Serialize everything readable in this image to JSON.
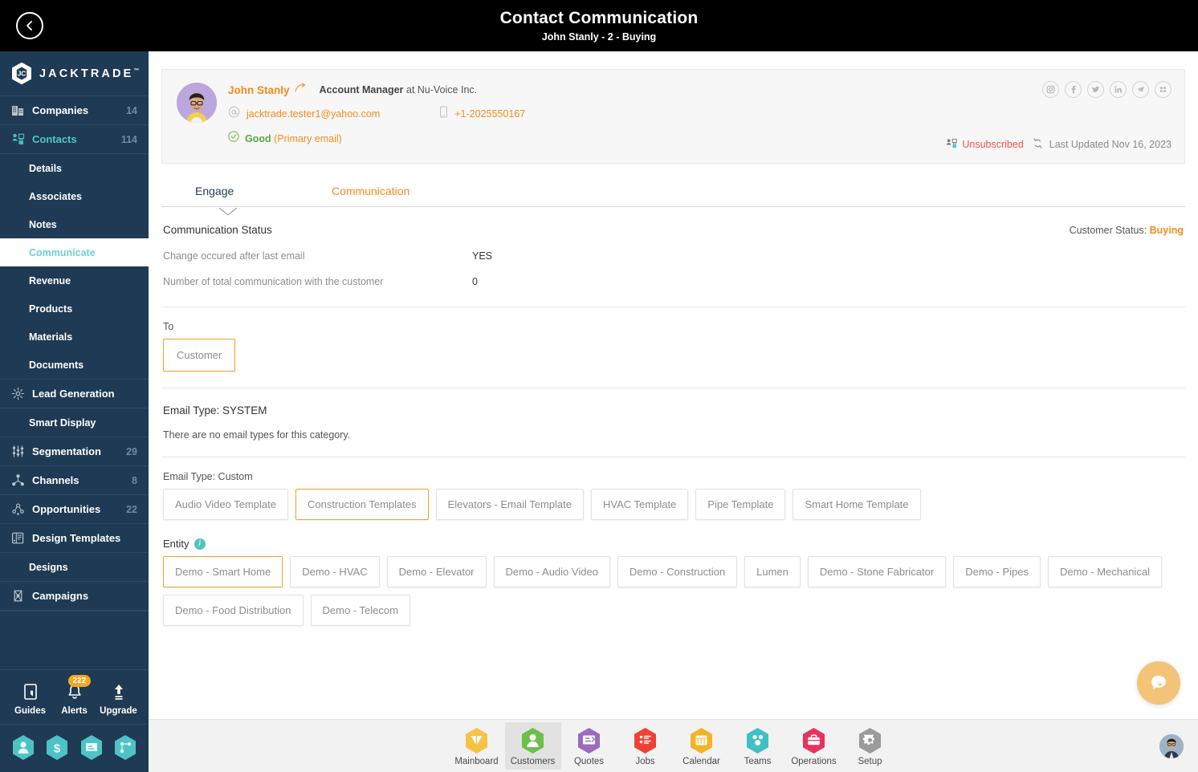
{
  "topbar": {
    "back_icon": "chevron-left-icon",
    "title": "Contact Communication",
    "subtitle": "John Stanly - 2 - Buying"
  },
  "sidebar": {
    "brand": {
      "name": "JACKTRADE",
      "tm": "™",
      "logo_icon": "jacktrade-hex-logo-icon"
    },
    "items": [
      {
        "label": "Companies",
        "count": "14",
        "icon": "building-icon",
        "level": "top",
        "active": false
      },
      {
        "label": "Contacts",
        "count": "114",
        "icon": "contacts-icon",
        "level": "top",
        "active": false,
        "accent": true
      },
      {
        "label": "Details",
        "count": "",
        "icon": "",
        "level": "sub",
        "active": false
      },
      {
        "label": "Associates",
        "count": "",
        "icon": "",
        "level": "sub",
        "active": false
      },
      {
        "label": "Notes",
        "count": "",
        "icon": "",
        "level": "sub",
        "active": false
      },
      {
        "label": "Communicate",
        "count": "",
        "icon": "",
        "level": "sub",
        "active": true
      },
      {
        "label": "Revenue",
        "count": "",
        "icon": "",
        "level": "sub",
        "active": false
      },
      {
        "label": "Products",
        "count": "",
        "icon": "",
        "level": "sub",
        "active": false
      },
      {
        "label": "Materials",
        "count": "",
        "icon": "",
        "level": "sub",
        "active": false
      },
      {
        "label": "Documents",
        "count": "",
        "icon": "",
        "level": "sub",
        "active": false
      },
      {
        "label": "Lead Generation",
        "count": "",
        "icon": "lead-generation-icon",
        "level": "top",
        "active": false
      },
      {
        "label": "Smart Display",
        "count": "",
        "icon": "",
        "level": "sub",
        "active": false
      },
      {
        "label": "Segmentation",
        "count": "29",
        "icon": "segmentation-icon",
        "level": "top",
        "active": false
      },
      {
        "label": "Channels",
        "count": "8",
        "icon": "channels-icon",
        "level": "top",
        "active": false
      },
      {
        "label": "Opportunities",
        "count": "22",
        "icon": "opportunities-icon",
        "level": "top",
        "active": false
      },
      {
        "label": "Design Templates",
        "count": "",
        "icon": "design-templates-icon",
        "level": "top",
        "active": false
      },
      {
        "label": "Designs",
        "count": "",
        "icon": "",
        "level": "sub",
        "active": false
      },
      {
        "label": "Campaigns",
        "count": "",
        "icon": "campaigns-icon",
        "level": "top",
        "active": false
      }
    ],
    "tools": [
      {
        "label": "Guides",
        "icon": "book-icon",
        "badge": ""
      },
      {
        "label": "Alerts",
        "icon": "bell-icon",
        "badge": "222"
      },
      {
        "label": "Upgrade",
        "icon": "arrow-up-icon",
        "badge": ""
      }
    ],
    "quick_hexes": [
      {
        "icon": "person-hex-icon"
      },
      {
        "icon": "dollar-hex-icon"
      },
      {
        "icon": "quote-card-hex-icon"
      },
      {
        "icon": "workflow-hex-icon"
      }
    ]
  },
  "contact": {
    "avatar_icon": "contact-avatar",
    "name": "John Stanly",
    "share_icon": "share-arrow-icon",
    "role": "Account Manager",
    "role_suffix": " at Nu-Voice Inc.",
    "email_icon": "at-icon",
    "email": "jacktrade.tester1@yahoo.com",
    "phone_icon": "mobile-icon",
    "phone": "+1-2025550167",
    "quality_icon": "check-circle-icon",
    "quality": "Good",
    "quality_note": "(Primary email)",
    "socials": [
      {
        "icon": "instagram-icon"
      },
      {
        "icon": "facebook-icon"
      },
      {
        "icon": "twitter-icon"
      },
      {
        "icon": "linkedin-icon"
      },
      {
        "icon": "telegram-icon"
      },
      {
        "icon": "apps-grid-icon"
      }
    ],
    "subscribe_icon": "contacts-lock-icon",
    "subscribe_status": "Unsubscribed",
    "refresh_icon": "refresh-icon",
    "last_updated": "Last Updated Nov 16, 2023"
  },
  "tabs": [
    {
      "label": "Engage",
      "active": true
    },
    {
      "label": "Communication",
      "active": false
    }
  ],
  "communication_status": {
    "title": "Communication Status",
    "customer_status_label": "Customer Status:",
    "customer_status_value": "Buying",
    "rows": [
      {
        "label": "Change occured after last email",
        "value": "YES"
      },
      {
        "label": "Number of total communication with the customer",
        "value": "0"
      }
    ]
  },
  "to_section": {
    "label": "To",
    "options": [
      {
        "label": "Customer",
        "selected": true
      }
    ]
  },
  "email_type_system": {
    "title": "Email Type: SYSTEM",
    "empty_message": "There are no email types for this category."
  },
  "email_type_custom": {
    "title": "Email Type: Custom",
    "options": [
      {
        "label": "Audio Video Template",
        "selected": false
      },
      {
        "label": "Construction Templates",
        "selected": true
      },
      {
        "label": "Elevators - Email Template",
        "selected": false
      },
      {
        "label": "HVAC Template",
        "selected": false
      },
      {
        "label": "Pipe Template",
        "selected": false
      },
      {
        "label": "Smart Home Template",
        "selected": false
      }
    ]
  },
  "entity": {
    "label": "Entity",
    "info_icon": "info-icon",
    "options": [
      {
        "label": "Demo - Smart Home",
        "selected": true
      },
      {
        "label": "Demo - HVAC",
        "selected": false
      },
      {
        "label": "Demo - Elevator",
        "selected": false
      },
      {
        "label": "Demo - Audio Video",
        "selected": false
      },
      {
        "label": "Demo - Construction",
        "selected": false
      },
      {
        "label": "Lumen",
        "selected": false
      },
      {
        "label": "Demo - Stone Fabricator",
        "selected": false
      },
      {
        "label": "Demo - Pipes",
        "selected": false
      },
      {
        "label": "Demo - Mechanical",
        "selected": false
      },
      {
        "label": "Demo - Food Distribution",
        "selected": false
      },
      {
        "label": "Demo - Telecom",
        "selected": false
      }
    ]
  },
  "bottom_nav": {
    "items": [
      {
        "label": "Mainboard",
        "icon": "mainboard-hex-icon",
        "color": "#f6c244",
        "active": false
      },
      {
        "label": "Customers",
        "icon": "customers-hex-icon",
        "color": "#6cc04a",
        "active": true
      },
      {
        "label": "Quotes",
        "icon": "quotes-hex-icon",
        "color": "#9b6bbd",
        "active": false
      },
      {
        "label": "Jobs",
        "icon": "jobs-hex-icon",
        "color": "#ef4136",
        "active": false
      },
      {
        "label": "Calendar",
        "icon": "calendar-hex-icon",
        "color": "#f5b324",
        "active": false
      },
      {
        "label": "Teams",
        "icon": "teams-hex-icon",
        "color": "#3fc0c4",
        "active": false
      },
      {
        "label": "Operations",
        "icon": "operations-hex-icon",
        "color": "#e8315c",
        "active": false
      },
      {
        "label": "Setup",
        "icon": "setup-hex-icon",
        "color": "#9b9b9b",
        "active": false
      }
    ],
    "avatar_icon": "user-avatar"
  },
  "chat": {
    "icon": "chat-bubble-icon"
  },
  "colors": {
    "sidebar_bg": "#1f3a54",
    "accent_orange": "#f08c1e",
    "accent_teal": "#52c5c7",
    "danger_red": "#ef5350",
    "success_green": "#5aa63c",
    "topbar_bg": "#000000"
  }
}
